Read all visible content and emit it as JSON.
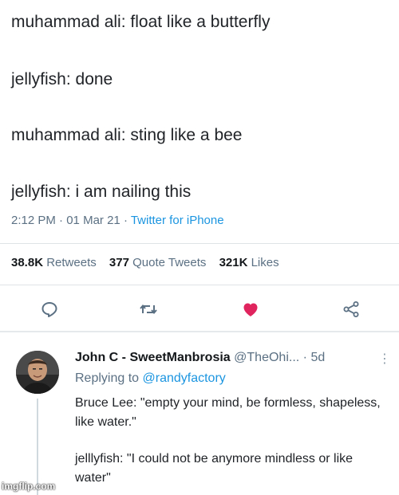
{
  "tweet": {
    "lines": [
      "muhammad ali: float like a butterfly",
      "jellyfish: done",
      "muhammad ali: sting like a bee",
      "jellyfish: i am nailing this"
    ],
    "time": "2:12 PM",
    "date": "01 Mar 21",
    "separator": "·",
    "source": "Twitter for iPhone",
    "stats": {
      "retweets_count": "38.8K",
      "retweets_label": "Retweets",
      "quotes_count": "377",
      "quotes_label": "Quote Tweets",
      "likes_count": "321K",
      "likes_label": "Likes"
    },
    "actions": {
      "reply_icon": "reply-icon",
      "retweet_icon": "retweet-icon",
      "like_icon": "heart-icon",
      "share_icon": "share-icon",
      "like_color": "#e0245e"
    }
  },
  "reply": {
    "name": "John C - SweetManbrosia",
    "handle": "@TheOhi...",
    "age_sep": "·",
    "age": "5d",
    "more": "⋮",
    "replying_prefix": "Replying to",
    "replying_to": "@randyfactory",
    "body_line1": "Bruce Lee: \"empty your mind, be formless, shapeless, like water.\"",
    "body_line2": "jelllyfish: \"I could not  be anymore mindless or like water\""
  },
  "watermark": "imgflip.com",
  "colors": {
    "link": "#1b95e0",
    "muted": "#5b7083",
    "text": "#14171a",
    "heart": "#e0245e"
  }
}
